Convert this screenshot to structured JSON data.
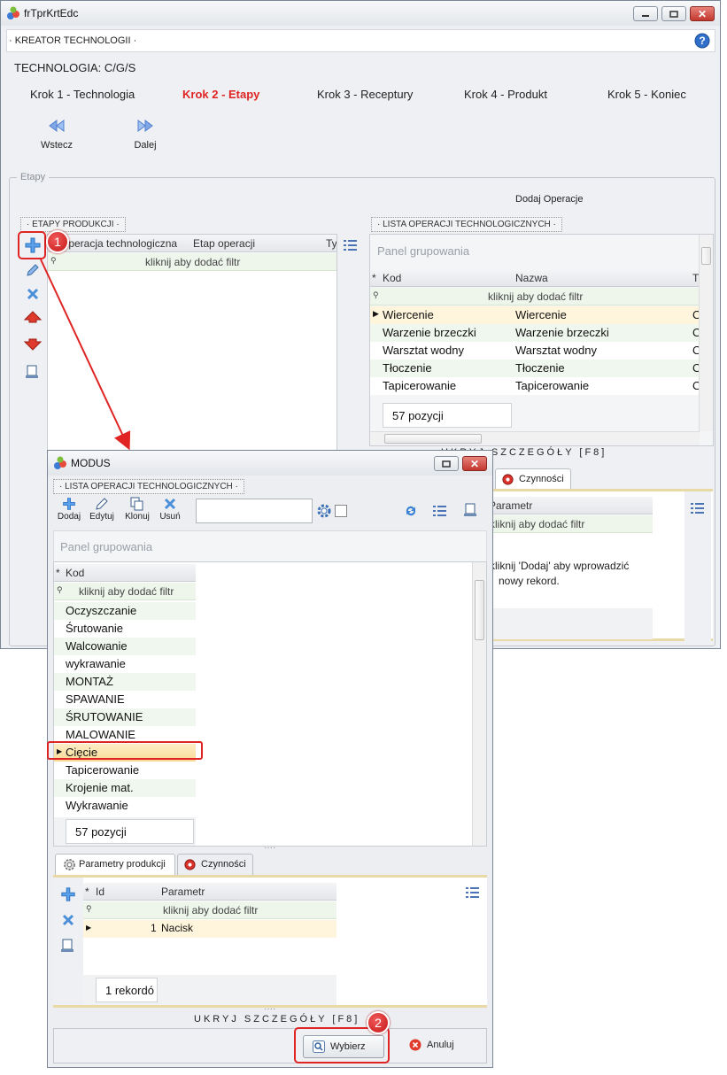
{
  "main": {
    "title": "frTprKrtEdc",
    "header": "KREATOR TECHNOLOGII",
    "technology_label": "TECHNOLOGIA: C/G/S",
    "steps": [
      "Krok 1 - Technologia",
      "Krok 2 - Etapy",
      "Krok 3 - Receptury",
      "Krok 4 - Produkt",
      "Krok 5 - Koniec"
    ],
    "back": "Wstecz",
    "next": "Dalej",
    "group_label": "Etapy",
    "add_ops": "Dodaj Operacje",
    "stages_label": "ETAPY PRODUKCJI",
    "stages_cols": [
      "Operacja technologiczna",
      "Etap operacji",
      "Ty"
    ],
    "filter_hint": "kliknij aby dodać filtr",
    "ops_label": "LISTA OPERACJI TECHNOLOGICZNYCH",
    "group_panel": "Panel grupowania",
    "ops_cols": [
      "Kod",
      "Nazwa",
      "T"
    ],
    "ops_rows": [
      {
        "kod": "Wiercenie",
        "nazwa": "Wiercenie",
        "t": "O"
      },
      {
        "kod": "Warzenie brzeczki",
        "nazwa": "Warzenie brzeczki",
        "t": "O"
      },
      {
        "kod": "Warsztat wodny",
        "nazwa": "Warsztat wodny",
        "t": "O"
      },
      {
        "kod": "Tłoczenie",
        "nazwa": "Tłoczenie",
        "t": "O"
      },
      {
        "kod": "Tapicerowanie",
        "nazwa": "Tapicerowanie",
        "t": "O"
      }
    ],
    "ops_count": "57 pozycji",
    "details_toggle": "UKRYJ SZCZEGÓŁY [F8]",
    "tab_activities": "Czynności",
    "param_col": "Parametr",
    "empty_hint": [
      "kliknij 'Dodaj' aby wprowadzić",
      "nowy rekord."
    ]
  },
  "modal": {
    "title": "MODUS",
    "list_label": "LISTA OPERACJI TECHNOLOGICZNYCH",
    "toolbar": [
      "Dodaj",
      "Edytuj",
      "Klonuj",
      "Usuń"
    ],
    "group_panel": "Panel grupowania",
    "col_kod": "Kod",
    "filter_hint": "kliknij aby dodać filtr",
    "rows": [
      "Oczyszczanie",
      "Śrutowanie",
      "Walcowanie",
      "wykrawanie",
      "MONTAŻ",
      "SPAWANIE",
      "ŚRUTOWANIE",
      "MALOWANIE",
      "Cięcie",
      "Tapicerowanie",
      "Krojenie mat.",
      "Wykrawanie"
    ],
    "count": "57 pozycji",
    "tab_params": "Parametry produkcji",
    "tab_activities": "Czynności",
    "param_cols": [
      "Id",
      "Parametr"
    ],
    "param_row": {
      "id": "1",
      "name": "Nacisk"
    },
    "param_count": "1 rekordó",
    "details_toggle": "UKRYJ SZCZEGÓŁY [F8]",
    "select": "Wybierz",
    "cancel": "Anuluj"
  },
  "badges": [
    "1",
    "2"
  ],
  "colors": {
    "active_step": "#e02424",
    "callout": "#e02424",
    "selected_row": "#fbe3a6"
  }
}
